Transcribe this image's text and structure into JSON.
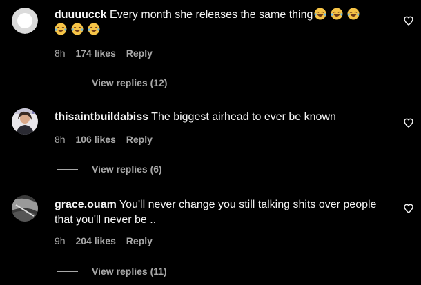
{
  "comments": [
    {
      "username": "duuuucck",
      "text": "Every month she releases the same thing",
      "emoji_icon": "face-with-tears-of-joy-icon",
      "time": "8h",
      "likes": "174 likes",
      "reply_label": "Reply",
      "view_replies": "View replies (12)"
    },
    {
      "username": "thisaintbuildabiss",
      "text": "The biggest airhead to ever be known",
      "time": "8h",
      "likes": "106 likes",
      "reply_label": "Reply",
      "view_replies": "View replies (6)"
    },
    {
      "username": "grace.ouam",
      "text": "You'll never change you still talking shits over people that you'll never be ..",
      "time": "9h",
      "likes": "204 likes",
      "reply_label": "Reply",
      "view_replies": "View replies (11)"
    }
  ],
  "colors": {
    "background": "#000000",
    "text": "#f5f5f5",
    "secondary": "#a8a8a8"
  },
  "icons": {
    "like": "heart-outline-icon"
  }
}
